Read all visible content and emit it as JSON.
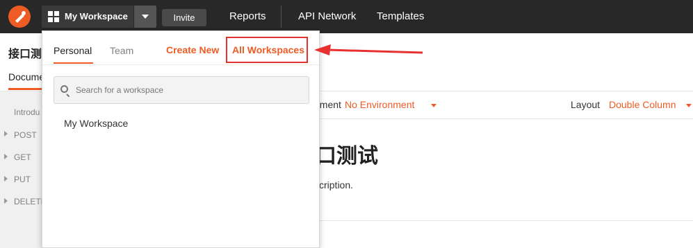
{
  "topbar": {
    "workspace_label": "My Workspace",
    "invite_label": "Invite",
    "nav": [
      "Reports",
      "API Network",
      "Templates"
    ]
  },
  "collection": {
    "title": "接口测",
    "tab_label": "Docume"
  },
  "sidebar": {
    "items": [
      {
        "label": "Introdu",
        "expandable": false
      },
      {
        "label": "POST",
        "expandable": true
      },
      {
        "label": "GET",
        "expandable": true
      },
      {
        "label": "PUT",
        "expandable": true
      },
      {
        "label": "DELETE",
        "expandable": true
      }
    ]
  },
  "main": {
    "environment_label": "nment",
    "environment_value": "No Environment",
    "layout_label": "Layout",
    "layout_value": "Double Column",
    "doc_title": "口测试",
    "doc_description": "scription."
  },
  "dropdown": {
    "tabs": [
      {
        "label": "Personal",
        "active": true
      },
      {
        "label": "Team",
        "active": false
      }
    ],
    "create_new": "Create New",
    "all_workspaces": "All Workspaces",
    "search_placeholder": "Search for a workspace",
    "workspaces": [
      "My Workspace"
    ]
  },
  "colors": {
    "accent": "#ef5b25",
    "topbar": "#282828",
    "annotation": "#e8302f"
  }
}
